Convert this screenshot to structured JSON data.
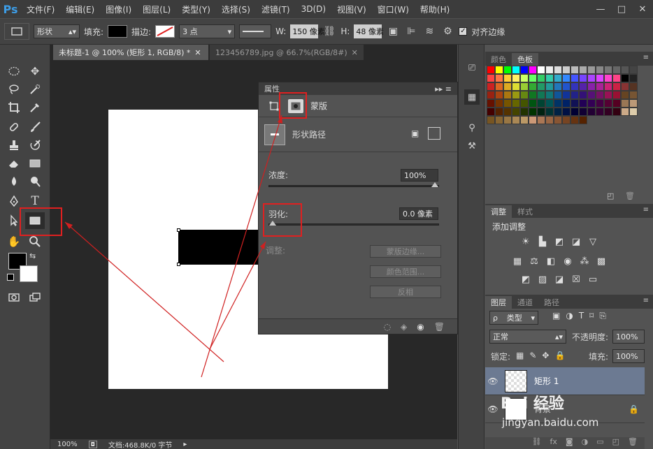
{
  "app": {
    "logo": "Ps"
  },
  "menu": [
    "文件(F)",
    "编辑(E)",
    "图像(I)",
    "图层(L)",
    "类型(Y)",
    "选择(S)",
    "滤镜(T)",
    "3D(D)",
    "视图(V)",
    "窗口(W)",
    "帮助(H)"
  ],
  "window_buttons": [
    "—",
    "□",
    "✕"
  ],
  "options": {
    "mode": "形状",
    "fill_label": "填充:",
    "stroke_label": "描边:",
    "stroke_size": "3 点",
    "w_label": "W:",
    "w_value": "150 像素",
    "h_label": "H:",
    "h_value": "48 像素",
    "align_label": "对齐边缘",
    "align_checked": "✓"
  },
  "tabs": [
    {
      "label": "未标题-1 @ 100% (矩形 1, RGB/8) *",
      "close": "✕"
    },
    {
      "label": "123456789.jpg @ 66.7%(RGB/8#)",
      "close": "✕"
    }
  ],
  "status": {
    "zoom": "100%",
    "doc": "文档:468.8K/0 字节"
  },
  "properties": {
    "title": "属性",
    "tab_label": "蒙版",
    "path_label": "形状路径",
    "density_label": "浓度:",
    "density_value": "100%",
    "density_level": 1.0,
    "feather_label": "羽化:",
    "feather_value": "0.0 像素",
    "feather_level": 0.0,
    "adjust_label": "调整:",
    "buttons": [
      "蒙版边缘...",
      "颜色范围...",
      "反相"
    ]
  },
  "color_panel": {
    "tabs": [
      "颜色",
      "色板"
    ]
  },
  "swatch_colors": [
    "#ff0000",
    "#ffff00",
    "#00ff00",
    "#00ffff",
    "#0000ff",
    "#ff00ff",
    "#ffffff",
    "#eeeeee",
    "#dddddd",
    "#cccccc",
    "#bbbbbb",
    "#aaaaaa",
    "#999999",
    "#888888",
    "#777777",
    "#666666",
    "#555555",
    "#444444",
    "#ff4444",
    "#ff7744",
    "#ffcc33",
    "#fff066",
    "#ccff66",
    "#66ff66",
    "#33cc66",
    "#33ccaa",
    "#33aacc",
    "#3388ff",
    "#4455ff",
    "#7744ff",
    "#aa44ff",
    "#dd44ff",
    "#ff44cc",
    "#ff4488",
    "#000000",
    "#222222",
    "#cc2222",
    "#dd6622",
    "#ddaa22",
    "#dddd33",
    "#99cc33",
    "#33aa33",
    "#229966",
    "#229999",
    "#2277bb",
    "#2255cc",
    "#3333bb",
    "#5522aa",
    "#8822aa",
    "#aa2299",
    "#cc2277",
    "#cc2244",
    "#883333",
    "#553322",
    "#992211",
    "#aa4411",
    "#aa7711",
    "#999911",
    "#668811",
    "#117722",
    "#117755",
    "#117777",
    "#115599",
    "#113399",
    "#222288",
    "#331177",
    "#551177",
    "#771166",
    "#991155",
    "#991133",
    "#664422",
    "#775533",
    "#661100",
    "#773300",
    "#775500",
    "#666600",
    "#445500",
    "#005511",
    "#004433",
    "#005555",
    "#003366",
    "#002266",
    "#111155",
    "#220055",
    "#330055",
    "#440044",
    "#550033",
    "#550022",
    "#997755",
    "#bb9977",
    "#440000",
    "#552200",
    "#553300",
    "#444400",
    "#223300",
    "#003300",
    "#002211",
    "#003333",
    "#002244",
    "#001144",
    "#000033",
    "#110033",
    "#220033",
    "#330033",
    "#330022",
    "#330011",
    "#ccaa88",
    "#ddccaa",
    "#775522",
    "#886633",
    "#997744",
    "#aa8855",
    "#bb9966",
    "#cc9977",
    "#aa7755",
    "#996644",
    "#885533",
    "#774422",
    "#663311",
    "#552200"
  ],
  "adjustments_panel": {
    "tabs": [
      "调整",
      "样式"
    ],
    "title": "添加调整"
  },
  "layers_panel": {
    "tabs": [
      "图层",
      "通道",
      "路径"
    ],
    "filter": "类型",
    "blend": "正常",
    "opacity_label": "不透明度:",
    "opacity_value": "100%",
    "lock_label": "锁定:",
    "fill_label": "填充:",
    "fill_value": "100%",
    "layers": [
      {
        "name": "矩形 1"
      },
      {
        "name": "背景"
      }
    ]
  },
  "watermark": {
    "brand": "Bai 经验",
    "url": "jingyan.baidu.com"
  }
}
